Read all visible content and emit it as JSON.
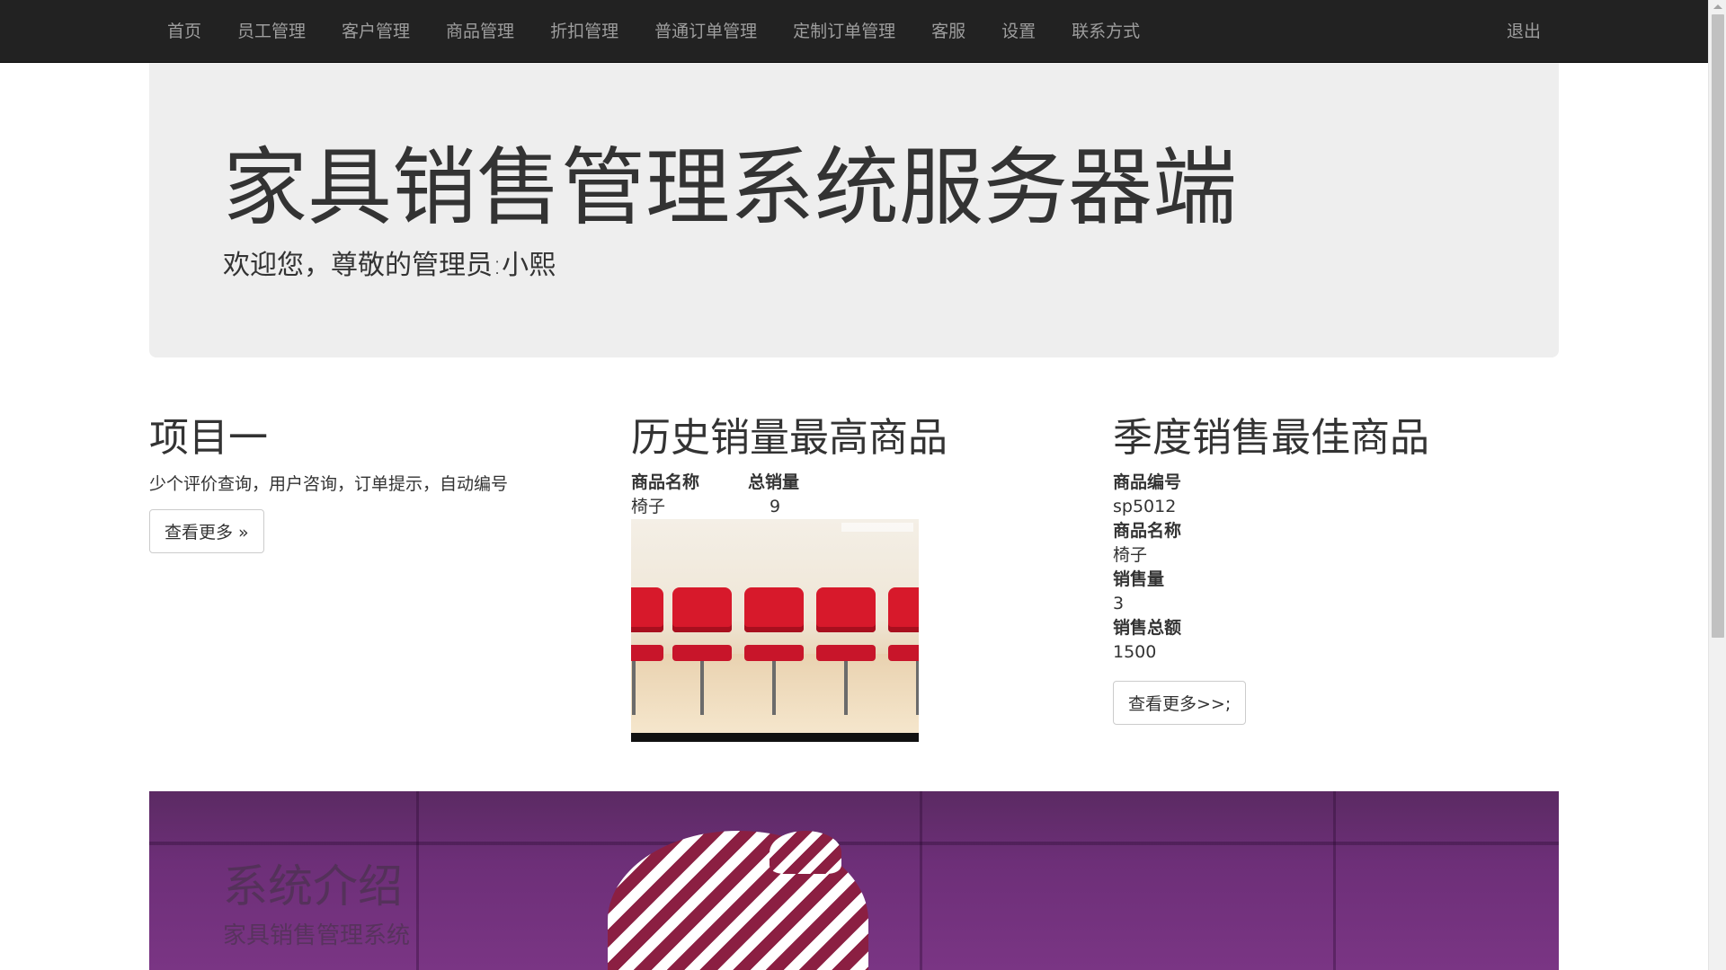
{
  "navbar": {
    "items": [
      "首页",
      "员工管理",
      "客户管理",
      "商品管理",
      "折扣管理",
      "普通订单管理",
      "定制订单管理",
      "客服",
      "设置",
      "联系方式"
    ],
    "logout": "退出"
  },
  "jumbotron": {
    "title": "家具销售管理系统服务器端",
    "subtitle": "欢迎您，尊敬的管理员:小熙"
  },
  "project": {
    "title": "项目一",
    "description": "少个评价查询，用户咨询，订单提示，自动编号",
    "button": "查看更多 »"
  },
  "top_history": {
    "title": "历史销量最高商品",
    "col_name_label": "商品名称",
    "col_total_label": "总销量",
    "name": "椅子",
    "total": "9",
    "image_icon": "red-chairs-photo"
  },
  "top_quarter": {
    "title": "季度销售最佳商品",
    "code_label": "商品编号",
    "code": "sp5012",
    "name_label": "商品名称",
    "name": "椅子",
    "sales_label": "销售量",
    "sales": "3",
    "amount_label": "销售总额",
    "amount": "1500",
    "button": "查看更多>>;"
  },
  "carousel": {
    "title": "系统介绍",
    "caption": "家具销售管理系统"
  },
  "colors": {
    "navbar_bg": "#222222",
    "jumbotron_bg": "#eeeeee",
    "nav_text": "#9d9d9d"
  }
}
